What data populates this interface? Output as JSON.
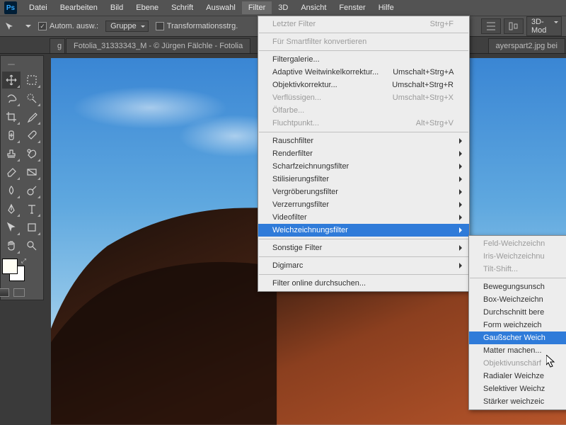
{
  "logo": "Ps",
  "menu": [
    "Datei",
    "Bearbeiten",
    "Bild",
    "Ebene",
    "Schrift",
    "Auswahl",
    "Filter",
    "3D",
    "Ansicht",
    "Fenster",
    "Hilfe"
  ],
  "activeMenuIndex": 6,
  "optbar": {
    "autoSelect": "Autom. ausw.:",
    "group": "Gruppe",
    "transform": "Transformationsstrg.",
    "mode3d": "3D-Mod"
  },
  "tabs": {
    "left1": "g",
    "left2": "Fotolia_31333343_M - © Jürgen Fälchle - Fotolia",
    "right": "ayerspart2.jpg bei"
  },
  "filterMenu": [
    {
      "t": "Letzter Filter",
      "sc": "Strg+F",
      "dis": true
    },
    {
      "sep": true
    },
    {
      "t": "Für Smartfilter konvertieren",
      "dis": true
    },
    {
      "sep": true
    },
    {
      "t": "Filtergalerie..."
    },
    {
      "t": "Adaptive Weitwinkelkorrektur...",
      "sc": "Umschalt+Strg+A"
    },
    {
      "t": "Objektivkorrektur...",
      "sc": "Umschalt+Strg+R"
    },
    {
      "t": "Verflüssigen...",
      "sc": "Umschalt+Strg+X",
      "dis": true
    },
    {
      "t": "Ölfarbe...",
      "dis": true
    },
    {
      "t": "Fluchtpunkt...",
      "sc": "Alt+Strg+V",
      "dis": true
    },
    {
      "sep": true
    },
    {
      "t": "Rauschfilter",
      "sub": true
    },
    {
      "t": "Renderfilter",
      "sub": true
    },
    {
      "t": "Scharfzeichnungsfilter",
      "sub": true
    },
    {
      "t": "Stilisierungsfilter",
      "sub": true
    },
    {
      "t": "Vergröberungsfilter",
      "sub": true
    },
    {
      "t": "Verzerrungsfilter",
      "sub": true
    },
    {
      "t": "Videofilter",
      "sub": true
    },
    {
      "t": "Weichzeichnungsfilter",
      "sub": true,
      "hi": true
    },
    {
      "sep": true
    },
    {
      "t": "Sonstige Filter",
      "sub": true
    },
    {
      "sep": true
    },
    {
      "t": "Digimarc",
      "sub": true
    },
    {
      "sep": true
    },
    {
      "t": "Filter online durchsuchen..."
    }
  ],
  "submenu": [
    {
      "t": "Feld-Weichzeichn",
      "dis": true
    },
    {
      "t": "Iris-Weichzeichnu",
      "dis": true
    },
    {
      "t": "Tilt-Shift...",
      "dis": true
    },
    {
      "sep": true
    },
    {
      "t": "Bewegungsunsch"
    },
    {
      "t": "Box-Weichzeichn"
    },
    {
      "t": "Durchschnitt bere"
    },
    {
      "t": "Form weichzeich"
    },
    {
      "t": "Gaußscher Weich",
      "hi": true
    },
    {
      "t": "Matter machen..."
    },
    {
      "t": "Objektivunschärf",
      "dis": true
    },
    {
      "t": "Radialer Weichze"
    },
    {
      "t": "Selektiver Weichz"
    },
    {
      "t": "Stärker weichzeic"
    }
  ]
}
